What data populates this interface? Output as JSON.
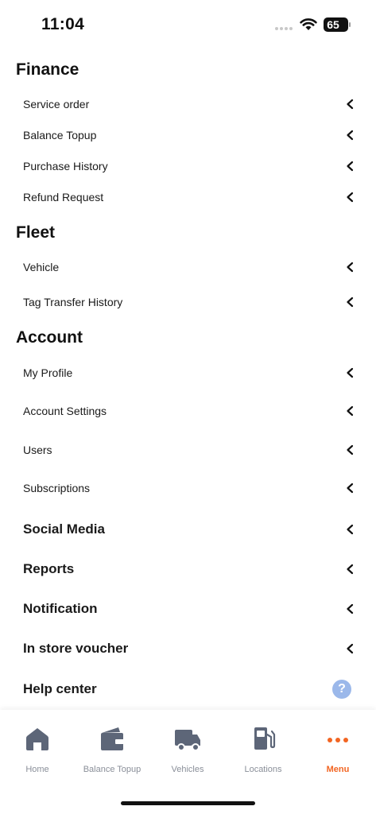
{
  "status_bar": {
    "time": "11:04",
    "battery": "65"
  },
  "sections": {
    "finance": {
      "title": "Finance",
      "items": [
        "Service order",
        "Balance Topup",
        "Purchase History",
        "Refund Request"
      ]
    },
    "fleet": {
      "title": "Fleet",
      "items": [
        "Vehicle",
        "Tag Transfer History"
      ]
    },
    "account": {
      "title": "Account",
      "items": [
        "My Profile",
        "Account Settings",
        "Users",
        "Subscriptions"
      ]
    }
  },
  "extra_items": [
    "Social Media",
    "Reports",
    "Notification",
    "In store voucher",
    "Help center"
  ],
  "help_icon_glyph": "?",
  "icons": {
    "chevron": "chevron-left-icon",
    "help": "question-circle-icon"
  },
  "tabbar": {
    "tabs": [
      {
        "label": "Home",
        "icon": "home-icon"
      },
      {
        "label": "Balance Topup",
        "icon": "wallet-icon"
      },
      {
        "label": "Vehicles",
        "icon": "truck-icon"
      },
      {
        "label": "Locations",
        "icon": "fuel-pump-icon"
      },
      {
        "label": "Menu",
        "icon": "more-dots-icon"
      }
    ],
    "active_color": "#f26522",
    "inactive_color": "#8a8f99"
  }
}
